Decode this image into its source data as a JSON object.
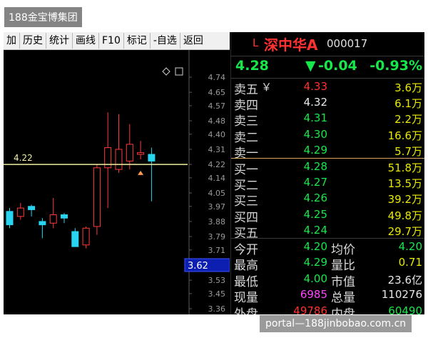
{
  "watermark": {
    "top": "188金宝博集团",
    "bottom": "portal—188jinbobao.com.cn"
  },
  "toolbar": {
    "items": [
      "加",
      "历史",
      "统计",
      "画线",
      "F10",
      "标记",
      "-自选",
      "返回"
    ]
  },
  "chart": {
    "price_axis": [
      "4.74",
      "4.65",
      "4.57",
      "4.48",
      "4.40",
      "4.31",
      "4.22",
      "4.14",
      "4.05",
      "3.97",
      "3.88",
      "3.79",
      "3.71",
      "3.62",
      "3.53",
      "3.45",
      "3.36"
    ],
    "reference_line": {
      "value": 4.22,
      "label": "4.22"
    },
    "cursor_label": "3.62",
    "candles": [
      {
        "open": 3.94,
        "close": 3.86,
        "high": 3.96,
        "low": 3.84,
        "dir": "down"
      },
      {
        "open": 3.91,
        "close": 3.96,
        "high": 3.99,
        "low": 3.89,
        "dir": "up"
      },
      {
        "open": 3.97,
        "close": 3.95,
        "high": 3.98,
        "low": 3.91,
        "dir": "flat"
      },
      {
        "open": 3.88,
        "close": 3.86,
        "high": 3.9,
        "low": 3.78,
        "dir": "flat"
      },
      {
        "open": 3.87,
        "close": 3.92,
        "high": 4.02,
        "low": 3.84,
        "dir": "up"
      },
      {
        "open": 3.92,
        "close": 3.9,
        "high": 3.93,
        "low": 3.87,
        "dir": "down"
      },
      {
        "open": 3.82,
        "close": 3.73,
        "high": 3.84,
        "low": 3.73,
        "dir": "flat"
      },
      {
        "open": 3.74,
        "close": 3.84,
        "high": 3.85,
        "low": 3.72,
        "dir": "up"
      },
      {
        "open": 3.85,
        "close": 4.2,
        "high": 4.22,
        "low": 3.8,
        "dir": "up"
      },
      {
        "open": 4.2,
        "close": 4.32,
        "high": 4.53,
        "low": 3.96,
        "dir": "up"
      },
      {
        "open": 4.19,
        "close": 4.31,
        "high": 4.52,
        "low": 4.17,
        "dir": "up"
      },
      {
        "open": 4.24,
        "close": 4.34,
        "high": 4.46,
        "low": 4.19,
        "dir": "up"
      },
      {
        "open": 4.28,
        "close": 4.29,
        "high": 4.36,
        "low": 4.25,
        "dir": "flat"
      },
      {
        "open": 4.28,
        "close": 4.24,
        "high": 4.32,
        "low": 4.0,
        "dir": "down"
      }
    ],
    "marker_price": 4.17
  },
  "quote": {
    "prefix": "L",
    "name": "深中华A",
    "code": "000017",
    "price": "4.28",
    "change_arrow": "▼",
    "change": "-0.04",
    "change_pct": "-0.93%",
    "colors": {
      "up": "#ff3232",
      "down": "#16e84a",
      "neutral": "#e8e8e8",
      "yellow": "#e8e800",
      "purple": "#ff44ff",
      "blue": "#4a90ff"
    },
    "asks": [
      {
        "label": "卖五",
        "mark": "￥",
        "price": "4.33",
        "vol": "3.6万",
        "color": "up"
      },
      {
        "label": "卖四",
        "mark": "",
        "price": "4.32",
        "vol": "6.1万",
        "color": "neutral"
      },
      {
        "label": "卖三",
        "mark": "",
        "price": "4.31",
        "vol": "2.2万",
        "color": "down"
      },
      {
        "label": "卖二",
        "mark": "",
        "price": "4.30",
        "vol": "16.6万",
        "color": "down"
      },
      {
        "label": "卖一",
        "mark": "",
        "price": "4.29",
        "vol": "5.7万",
        "color": "down"
      }
    ],
    "bids": [
      {
        "label": "买一",
        "price": "4.28",
        "vol": "51.8万",
        "color": "down"
      },
      {
        "label": "买二",
        "price": "4.27",
        "vol": "13.5万",
        "color": "down"
      },
      {
        "label": "买三",
        "price": "4.26",
        "vol": "39.2万",
        "color": "down"
      },
      {
        "label": "买四",
        "price": "4.25",
        "vol": "49.8万",
        "color": "down"
      },
      {
        "label": "买五",
        "price": "4.24",
        "vol": "29.7万",
        "color": "down"
      }
    ],
    "stats": [
      {
        "l1": "今开",
        "v1": "4.20",
        "c1": "down",
        "l2": "均价",
        "v2": "4.20",
        "c2": "down"
      },
      {
        "l1": "最高",
        "v1": "4.29",
        "c1": "down",
        "l2": "量比",
        "v2": "0.71",
        "c2": "yellow"
      },
      {
        "l1": "最低",
        "v1": "4.00",
        "c1": "down",
        "l2": "市值",
        "v2": "23.6亿",
        "c2": "neutral"
      },
      {
        "l1": "现量",
        "v1": "6985",
        "c1": "purple",
        "l2": "总量",
        "v2": "110276",
        "c2": "neutral"
      },
      {
        "l1": "外盘",
        "v1": "49786",
        "c1": "up",
        "l2": "内盘",
        "v2": "60490",
        "c2": "down"
      }
    ]
  }
}
